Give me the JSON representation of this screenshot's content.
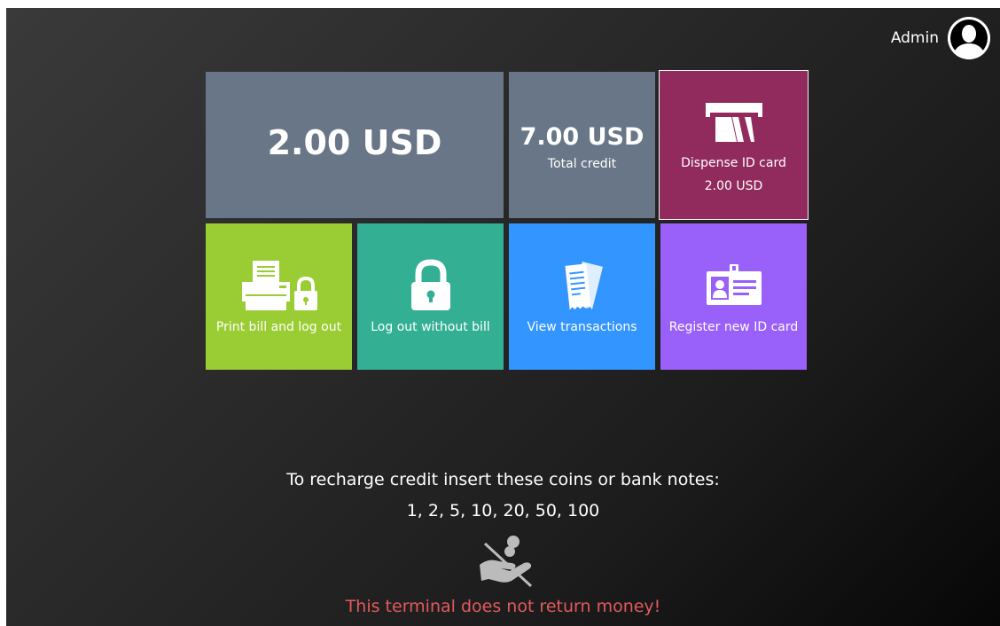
{
  "user": {
    "name": "Admin",
    "avatar_icon": "user-avatar-icon"
  },
  "tiles": {
    "amount": {
      "value": "2.00 USD",
      "color": "#687687"
    },
    "total": {
      "value": "7.00 USD",
      "label": "Total credit",
      "color": "#687687"
    },
    "dispense": {
      "label": "Dispense ID card",
      "price": "2.00 USD",
      "icon": "card-dispenser-icon",
      "color": "#922b5d"
    },
    "print": {
      "label": "Print bill and log out",
      "icon": "printer-lock-icon",
      "color": "#9acc33"
    },
    "logout": {
      "label": "Log out without bill",
      "icon": "lock-icon",
      "color": "#33af94"
    },
    "view": {
      "label": "View transactions",
      "icon": "receipts-icon",
      "color": "#3395ff"
    },
    "register": {
      "label": "Register new ID card",
      "icon": "id-card-icon",
      "color": "#9a60fa"
    }
  },
  "footer": {
    "recharge_text": "To recharge credit insert these coins or bank notes:",
    "denominations": "1, 2, 5, 10, 20, 50, 100",
    "no_return_icon": "no-money-return-icon",
    "warning": "This terminal does not return money!",
    "warning_color": "#e35a5a"
  }
}
